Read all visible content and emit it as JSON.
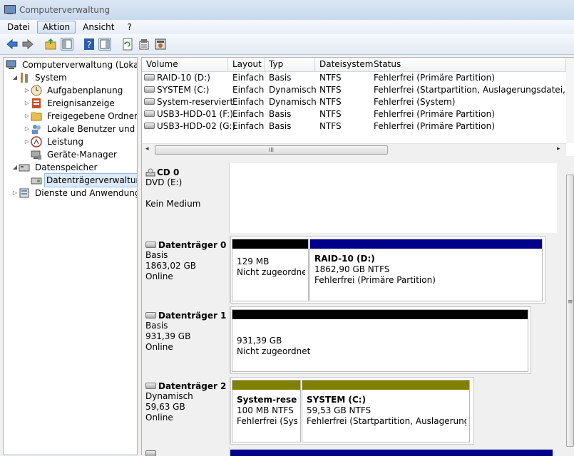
{
  "window": {
    "title": "Computerverwaltung"
  },
  "menu": {
    "items": [
      "Datei",
      "Aktion",
      "Ansicht",
      "?"
    ]
  },
  "tree": {
    "root": "Computerverwaltung (Lokal)",
    "system": "System",
    "aufgaben": "Aufgabenplanung",
    "ereignis": "Ereignisanzeige",
    "freigaben": "Freigegebene Ordner",
    "benutzer": "Lokale Benutzer und Gruppen",
    "leistung": "Leistung",
    "geraete": "Geräte-Manager",
    "datenspeicher": "Datenspeicher",
    "datentraeger": "Datenträgerverwaltung",
    "dienste": "Dienste und Anwendungen"
  },
  "volumes": {
    "headers": {
      "volume": "Volume",
      "layout": "Layout",
      "typ": "Typ",
      "fs": "Dateisystem",
      "status": "Status"
    },
    "rows": [
      {
        "name": "RAID-10 (D:)",
        "layout": "Einfach",
        "typ": "Basis",
        "fs": "NTFS",
        "status": "Fehlerfrei (Primäre Partition)"
      },
      {
        "name": "SYSTEM (C:)",
        "layout": "Einfach",
        "typ": "Dynamisch",
        "fs": "NTFS",
        "status": "Fehlerfrei (Startpartition, Auslagerungsdatei, Absturzspeicherabbild)"
      },
      {
        "name": "System-reserviert",
        "layout": "Einfach",
        "typ": "Dynamisch",
        "fs": "NTFS",
        "status": "Fehlerfrei (System)"
      },
      {
        "name": "USB3-HDD-01 (F:)",
        "layout": "Einfach",
        "typ": "Basis",
        "fs": "NTFS",
        "status": "Fehlerfrei (Primäre Partition)"
      },
      {
        "name": "USB3-HDD-02 (G:)",
        "layout": "Einfach",
        "typ": "Basis",
        "fs": "NTFS",
        "status": "Fehlerfrei (Primäre Partition)"
      }
    ]
  },
  "disks": {
    "cd0": {
      "name": "CD 0",
      "type": "DVD (E:)",
      "status": "Kein Medium"
    },
    "d0": {
      "name": "Datenträger 0",
      "type": "Basis",
      "size": "1863,02 GB",
      "status": "Online",
      "p1": {
        "size": "129 MB",
        "status": "Nicht zugeordnet"
      },
      "p2": {
        "title": "RAID-10  (D:)",
        "size": "1862,90 GB NTFS",
        "status": "Fehlerfrei (Primäre Partition)"
      }
    },
    "d1": {
      "name": "Datenträger 1",
      "type": "Basis",
      "size": "931,39 GB",
      "status": "Online",
      "p1": {
        "size": "931,39 GB",
        "status": "Nicht zugeordnet"
      }
    },
    "d2": {
      "name": "Datenträger 2",
      "type": "Dynamisch",
      "size": "59,63 GB",
      "status": "Online",
      "p1": {
        "title": "System-reserv",
        "size": "100 MB NTFS",
        "status": "Fehlerfrei (Syste"
      },
      "p2": {
        "title": "SYSTEM  (C:)",
        "size": "59,53 GB NTFS",
        "status": "Fehlerfrei (Startpartition, Auslagerungsdat"
      }
    }
  },
  "colors": {
    "unallocated": "#000000",
    "primary": "#00008b",
    "dynamic": "#808000"
  },
  "scroll_grip": "≡",
  "hscroll_grip": "III"
}
